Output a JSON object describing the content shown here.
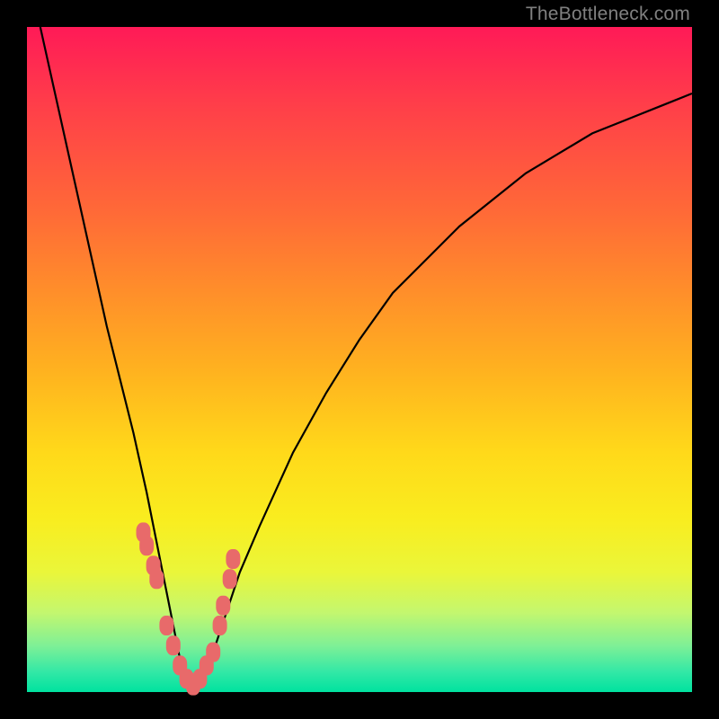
{
  "watermark": "TheBottleneck.com",
  "colors": {
    "frame": "#000000",
    "gradient_top": "#ff1a57",
    "gradient_bottom": "#00e29f",
    "curve_stroke": "#000000",
    "marker_fill": "#e86a6a"
  },
  "chart_data": {
    "type": "line",
    "title": "",
    "xlabel": "",
    "ylabel": "",
    "xlim": [
      0,
      100
    ],
    "ylim": [
      0,
      100
    ],
    "series": [
      {
        "name": "bottleneck-curve",
        "x": [
          2,
          4,
          6,
          8,
          10,
          12,
          14,
          16,
          18,
          20,
          21,
          22,
          23,
          24,
          25,
          26,
          28,
          30,
          32,
          35,
          40,
          45,
          50,
          55,
          60,
          65,
          70,
          75,
          80,
          85,
          90,
          95,
          100
        ],
        "y": [
          100,
          91,
          82,
          73,
          64,
          55,
          47,
          39,
          30,
          20,
          15,
          10,
          5,
          2,
          1,
          2,
          6,
          12,
          18,
          25,
          36,
          45,
          53,
          60,
          65,
          70,
          74,
          78,
          81,
          84,
          86,
          88,
          90
        ]
      }
    ],
    "markers": {
      "name": "highlighted-points",
      "x": [
        17.5,
        18.0,
        19.0,
        19.5,
        21.0,
        22.0,
        23.0,
        24.0,
        25.0,
        26.0,
        27.0,
        28.0,
        29.0,
        29.5,
        30.5,
        31.0
      ],
      "y": [
        24,
        22,
        19,
        17,
        10,
        7,
        4,
        2,
        1,
        2,
        4,
        6,
        10,
        13,
        17,
        20
      ]
    }
  }
}
